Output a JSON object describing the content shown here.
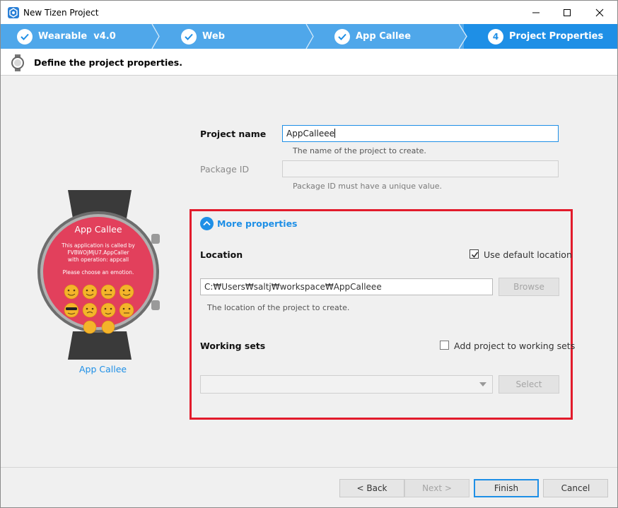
{
  "window": {
    "title": "New Tizen Project"
  },
  "steps": [
    {
      "label": "Wearable  v4.0",
      "state": "done"
    },
    {
      "label": "Web",
      "state": "done"
    },
    {
      "label": "App Callee",
      "state": "done"
    },
    {
      "label": "Project Properties",
      "state": "current",
      "number": "4"
    }
  ],
  "header": {
    "text": "Define the project properties."
  },
  "preview": {
    "app_title": "App Callee",
    "body_lines": [
      "This application is called by",
      "FVBWOjMjU7.AppCaller",
      "with operation: appcall"
    ],
    "prompt": "Please choose an emotion.",
    "label": "App Callee"
  },
  "form": {
    "project_name_label": "Project name",
    "project_name_value": "AppCalleee",
    "project_name_hint": "The name of the project to create.",
    "package_id_label": "Package ID",
    "package_id_value": "",
    "package_id_hint": "Package ID must have a unique value."
  },
  "more": {
    "toggle_label": "More properties",
    "location_label": "Location",
    "use_default_label": "Use default location",
    "use_default_checked": true,
    "location_value": "C:₩Users₩saltj₩workspace₩AppCalleee",
    "browse_label": "Browse",
    "location_hint": "The location of the project to create.",
    "working_sets_label": "Working sets",
    "add_working_sets_label": "Add project to working sets",
    "add_working_sets_checked": false,
    "working_sets_value": "",
    "select_label": "Select"
  },
  "footer": {
    "back_label": "< Back",
    "next_label": "Next >",
    "finish_label": "Finish",
    "cancel_label": "Cancel"
  },
  "colors": {
    "step_bar": "#4fa7ea",
    "step_current": "#1e8fe6",
    "highlight": "#e21b2b",
    "watch_face": "#e2405c"
  }
}
